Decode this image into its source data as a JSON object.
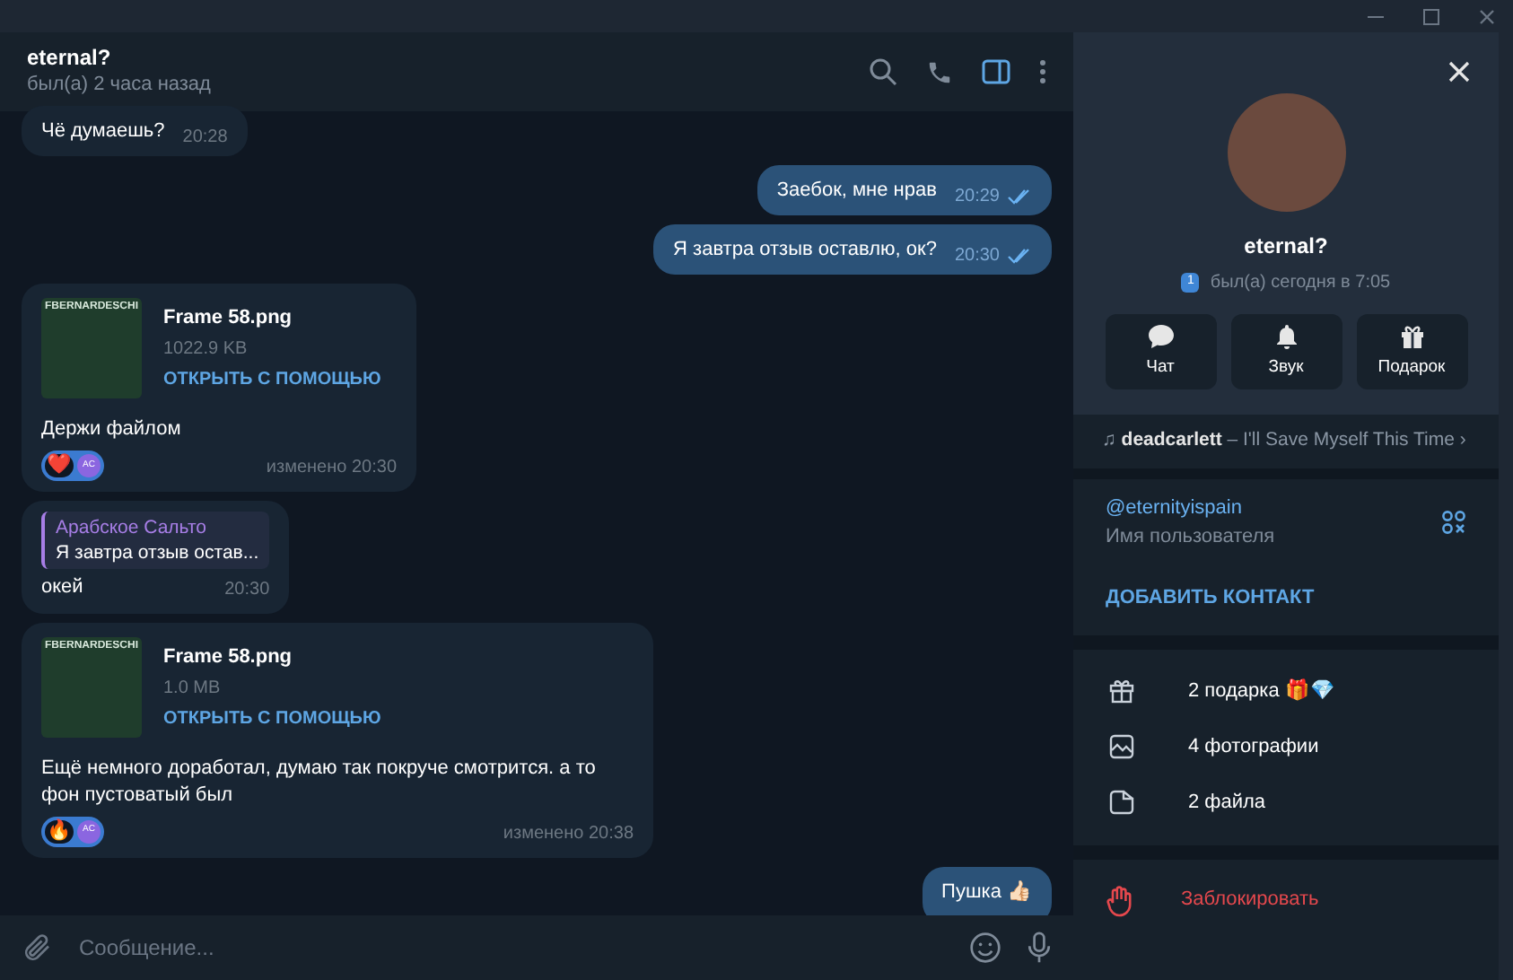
{
  "chat_header": {
    "title": "eternal?",
    "status": "был(а) 2 часа назад"
  },
  "messages": [
    {
      "kind": "text",
      "outgoing": false,
      "text": "Чё думаешь?",
      "time": "20:28"
    },
    {
      "kind": "text",
      "outgoing": true,
      "text": "Заебок, мне нрав",
      "time": "20:29",
      "read": true
    },
    {
      "kind": "text",
      "outgoing": true,
      "text": "Я завтра отзыв оставлю, ок?",
      "time": "20:30",
      "read": true
    },
    {
      "kind": "file",
      "outgoing": false,
      "thumb_label": "FBERNARDESCHI",
      "file_name": "Frame 58.png",
      "size": "1022.9 KB",
      "action": "ОТКРЫТЬ С ПОМОЩЬЮ",
      "text": "Держи файлом",
      "reaction": "❤️",
      "reactor": "AC",
      "time": "изменено 20:30"
    },
    {
      "kind": "reply",
      "outgoing": false,
      "reply_author": "Арабское Сальто",
      "reply_text": "Я завтра отзыв остав...",
      "text": "окей",
      "time": "20:30"
    },
    {
      "kind": "file",
      "outgoing": false,
      "thumb_label": "FBERNARDESCHI",
      "file_name": "Frame 58.png",
      "size": "1.0 MB",
      "action": "ОТКРЫТЬ С ПОМОЩЬЮ",
      "text": "Ещё немного доработал, думаю так покруче смотрится. а то фон пустоватый был",
      "reaction": "🔥",
      "reactor": "AC",
      "time": "изменено 20:38"
    },
    {
      "kind": "text",
      "outgoing": true,
      "text": "Пушка 👍🏻"
    }
  ],
  "composer": {
    "placeholder": "Сообщение..."
  },
  "profile": {
    "name": "eternal?",
    "badge": "1",
    "status": "был(а) сегодня в 7:05",
    "actions": [
      {
        "kind": "chat",
        "label": "Чат"
      },
      {
        "kind": "bell",
        "label": "Звук"
      },
      {
        "kind": "gift",
        "label": "Подарок"
      }
    ],
    "music": {
      "note": "♫",
      "chevron": "›",
      "artist": "deadcarlett",
      "title": "– I'll Save Myself This Time"
    },
    "username": "@eternityispain",
    "username_caption": "Имя пользователя",
    "add_contact": "ДОБАВИТЬ КОНТАКТ",
    "media": [
      {
        "kind": "gift",
        "label": "2 подарка 🎁💎"
      },
      {
        "kind": "photo",
        "label": "4 фотографии"
      },
      {
        "kind": "file",
        "label": "2 файла"
      }
    ],
    "block": "Заблокировать"
  }
}
